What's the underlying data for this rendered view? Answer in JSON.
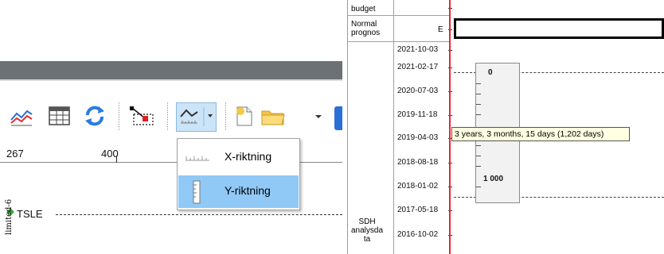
{
  "toolbar": {
    "icons": [
      "trend-chart-icon",
      "table-icon",
      "refresh-icon",
      "line-select-icon",
      "trend-dropdown-icon",
      "page-icon",
      "folder-icon"
    ]
  },
  "ruler": {
    "labels": [
      "267",
      "400"
    ]
  },
  "dropdown": {
    "items": [
      {
        "label": "X-riktning",
        "icon": "x-ruler-icon",
        "selected": false
      },
      {
        "label": "Y-riktning",
        "icon": "y-ruler-icon",
        "selected": true
      }
    ]
  },
  "plot": {
    "series_label": "TSLE",
    "rotated_label": "limited-6"
  },
  "right": {
    "header_budget": "budget",
    "header_normal": "Normal prognos",
    "normal_value": "E",
    "row_label": "SDH analysda ta",
    "dates": [
      "2021-10-03",
      "2021-02-17",
      "2020-07-03",
      "2019-11-18",
      "2019-04-03",
      "2018-08-18",
      "2018-01-02",
      "2017-05-18",
      "2016-10-02"
    ],
    "bar_values": [
      "0",
      "1 000"
    ],
    "tooltip": "3 years, 3 months, 15 days (1,202 days)",
    "accent_red": "#e0283a",
    "highlight_blue": "#90c8f6"
  }
}
